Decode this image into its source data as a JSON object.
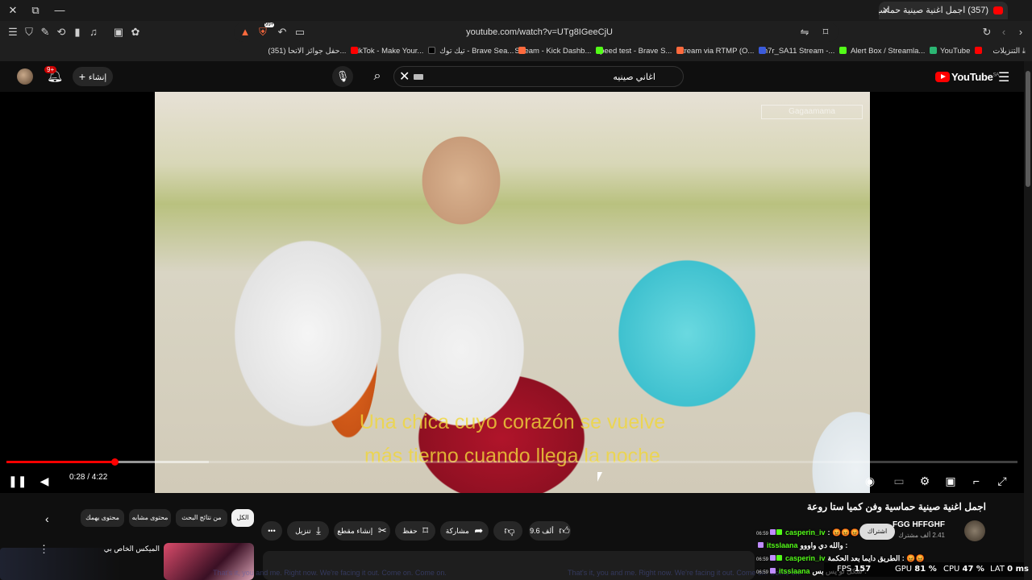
{
  "browser": {
    "tab_title": "(357) اجمل اغنية صينية حماسية",
    "tab_close": "✕",
    "new_tab": "+",
    "win_close": "✕",
    "win_max": "⧉",
    "win_min": "—",
    "shields_count": "99+",
    "url": "youtube.com/watch?v=UTg8IGeeCjU",
    "bookmarks": [
      {
        "label": "التنزيلات"
      },
      {
        "label": "YouTube"
      },
      {
        "label": "Alert Box / Streamla..."
      },
      {
        "label": "n7r_SA11 Stream -..."
      },
      {
        "label": "Stream via RTMP (O..."
      },
      {
        "label": "speed test - Brave S..."
      },
      {
        "label": "Stream - Kick Dashb..."
      },
      {
        "label": "تيك توك - Brave Sea..."
      },
      {
        "label": "TikTok - Make Your..."
      },
      {
        "label": "(351) حفل جوائز الاتحا..."
      }
    ]
  },
  "yt_header": {
    "logo": "YouTube",
    "region": "SA",
    "search_value": "اغاني صينيه",
    "notification_badge": "9+",
    "create_label": "إنشاء"
  },
  "player": {
    "subtitle_line1": "Una chica cuyo corazón se vuelve",
    "subtitle_line2": "más tierno cuando llega la noche",
    "watermark": "Gagaamama",
    "time_current": "0:28",
    "time_total": "4:22",
    "time_display": "0:28 / 4:22",
    "progress_played": 0.107,
    "progress_buffered": 0.2
  },
  "video_info": {
    "title": "اجمل اغنية صينية حماسية وفن كميا ستا روعة",
    "channel_name": "FGG HFFGHF",
    "channel_subs": "2.41 ألف مشترك",
    "subscribe_label": "اشتراك",
    "likes": "9.6 ألف",
    "share_label": "مشاركة",
    "save_label": "حفظ",
    "clip_label": "إنشاء مقطع",
    "download_label": "تنزيل"
  },
  "chips": {
    "all": "الكل",
    "from_search": "من نتائج البحث",
    "similar": "محتوى مشابه",
    "for_you": "محتوى يهمك"
  },
  "recommendation": {
    "title": "الميكس الخاص بي"
  },
  "chat": [
    {
      "time": "06:59",
      "user": "casperin_iv",
      "msg": ": 😡😡😡"
    },
    {
      "time": "",
      "user": "itsslaana",
      "msg": "والله دي واووو :"
    },
    {
      "time": "06:59",
      "user": "casperin_iv",
      "msg": "الطريق دايما بعد الحكمة : 😡😡"
    },
    {
      "time": "06:59",
      "user": "itsslaana",
      "msg": "شكل تو يس بس :"
    }
  ],
  "perf": {
    "fps_label": "FPS",
    "fps": "157",
    "gpu_label": "GPU",
    "gpu": "81 %",
    "cpu_label": "CPU",
    "cpu": "47 %",
    "lat_label": "LAT",
    "lat": "0 ms"
  },
  "ticker": {
    "left": "That's it, you and me. Right now. We're facing it out. Come on. Come on.",
    "right": "That's it, you and me. Right now. We're facing it out. Come on. Come on."
  }
}
